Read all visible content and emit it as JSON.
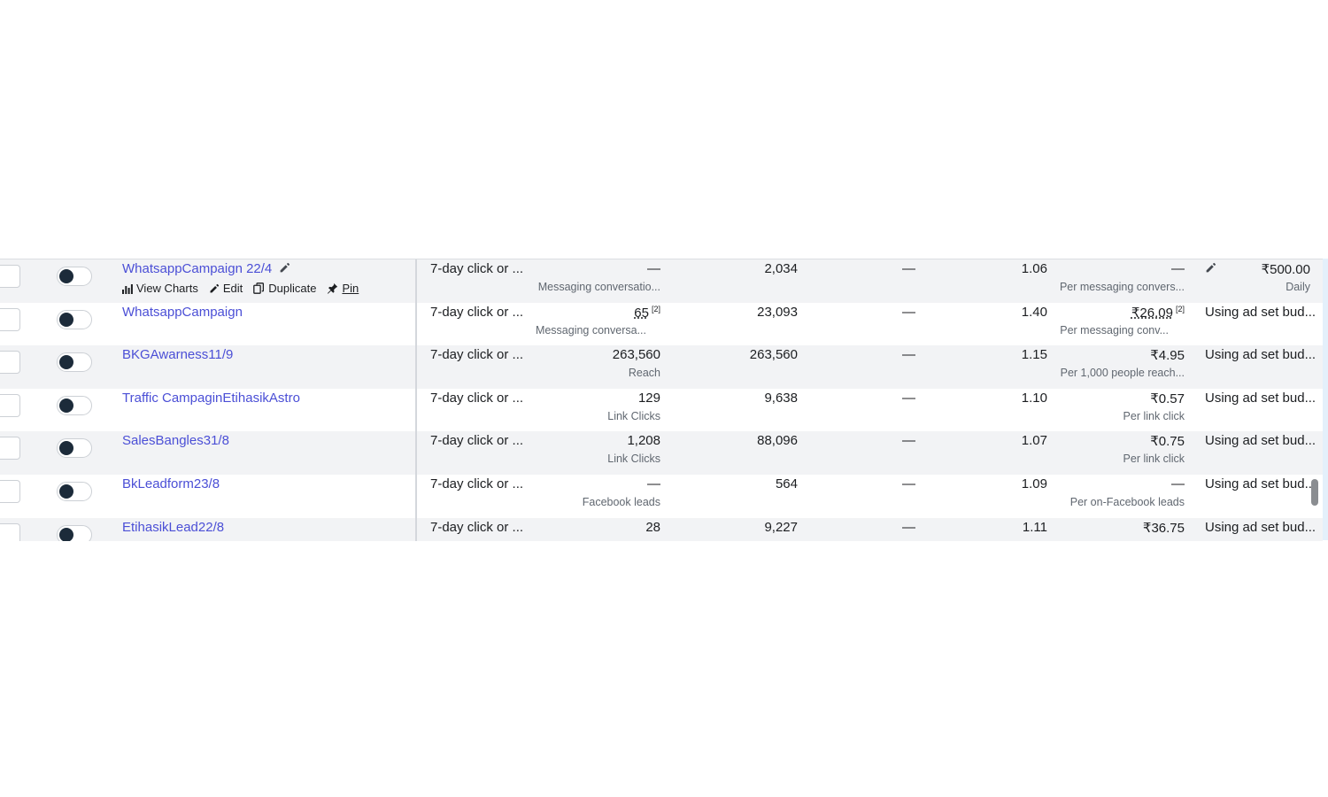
{
  "rows": [
    {
      "name": "WhatsappCampaign 22/4",
      "attribution": "7-day click or ...",
      "results": "—",
      "results_sub": "Messaging conversatio...",
      "reach": "2,034",
      "impressions": "—",
      "frequency": "1.06",
      "cost": "—",
      "cost_sub": "Per messaging convers...",
      "budget": "₹500.00",
      "budget_sub": "Daily",
      "actions": {
        "view_charts": "View Charts",
        "edit": "Edit",
        "duplicate": "Duplicate",
        "pin": "Pin"
      }
    },
    {
      "name": "WhatsappCampaign",
      "attribution": "7-day click or ...",
      "results": "65",
      "results_note": "[2]",
      "results_sub": "Messaging conversa...",
      "reach": "23,093",
      "impressions": "—",
      "frequency": "1.40",
      "cost": "₹26.09",
      "cost_note": "[2]",
      "cost_sub": "Per messaging conv...",
      "budget": "Using ad set bud..."
    },
    {
      "name": "BKGAwarness11/9",
      "attribution": "7-day click or ...",
      "results": "263,560",
      "results_sub": "Reach",
      "reach": "263,560",
      "impressions": "—",
      "frequency": "1.15",
      "cost": "₹4.95",
      "cost_sub": "Per 1,000 people reach...",
      "budget": "Using ad set bud..."
    },
    {
      "name": "Traffic CampaginEtihasikAstro",
      "attribution": "7-day click or ...",
      "results": "129",
      "results_sub": "Link Clicks",
      "reach": "9,638",
      "impressions": "—",
      "frequency": "1.10",
      "cost": "₹0.57",
      "cost_sub": "Per link click",
      "budget": "Using ad set bud..."
    },
    {
      "name": "SalesBangles31/8",
      "attribution": "7-day click or ...",
      "results": "1,208",
      "results_sub": "Link Clicks",
      "reach": "88,096",
      "impressions": "—",
      "frequency": "1.07",
      "cost": "₹0.75",
      "cost_sub": "Per link click",
      "budget": "Using ad set bud..."
    },
    {
      "name": "BkLeadform23/8",
      "attribution": "7-day click or ...",
      "results": "—",
      "results_sub": "Facebook leads",
      "reach": "564",
      "impressions": "—",
      "frequency": "1.09",
      "cost": "—",
      "cost_sub": "Per on-Facebook leads",
      "budget": "Using ad set bud..."
    },
    {
      "name": "EtihasikLead22/8",
      "attribution": "7-day click or ...",
      "results": "28",
      "results_sub": "",
      "reach": "9,227",
      "impressions": "—",
      "frequency": "1.11",
      "cost": "₹36.75",
      "cost_sub": "",
      "budget": "Using ad set bud..."
    }
  ],
  "colors": {
    "link": "#4b4fd6",
    "row_alt": "#f2f3f5",
    "toggle_knob": "#1c2b3a"
  }
}
